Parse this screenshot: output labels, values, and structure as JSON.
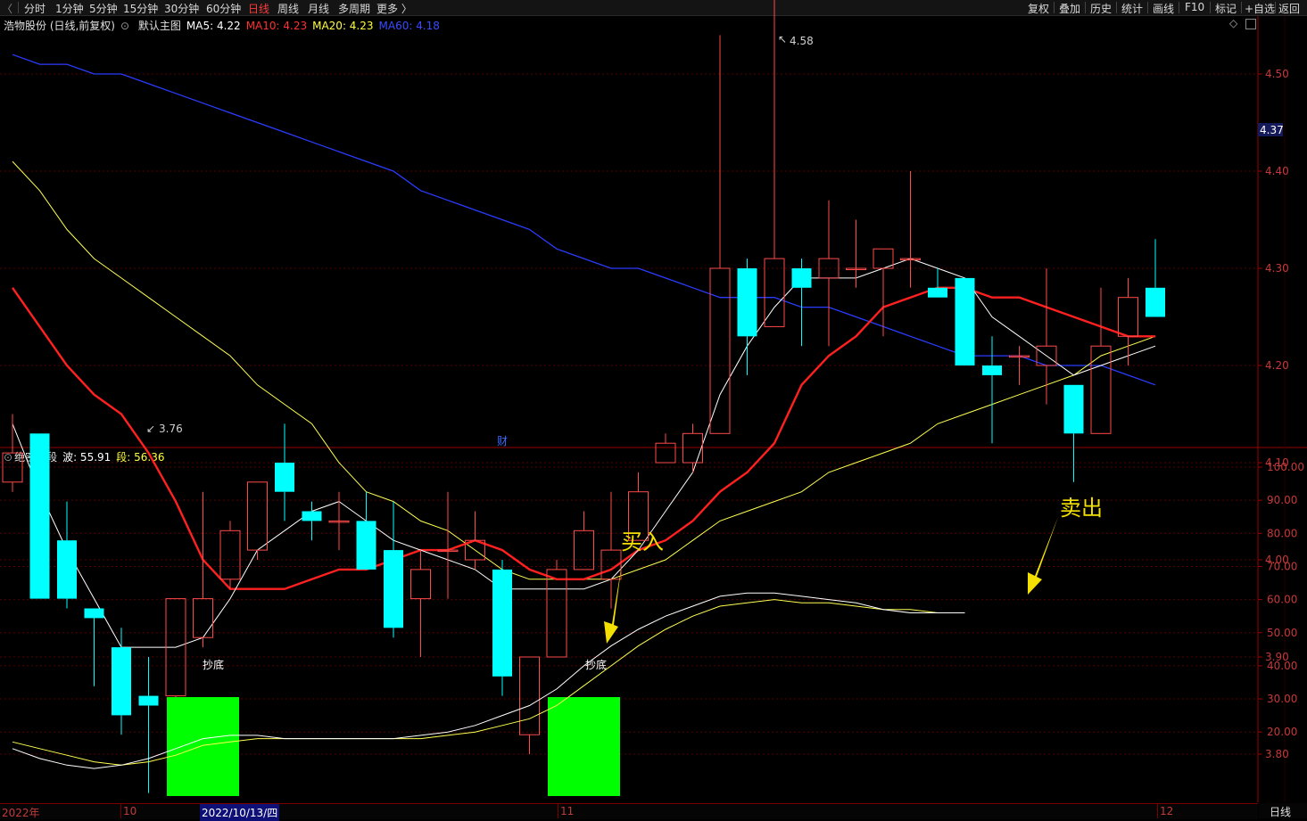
{
  "toolbar": {
    "periods": [
      "分时",
      "1分钟",
      "5分钟",
      "15分钟",
      "30分钟",
      "60分钟",
      "日线",
      "周线",
      "月线",
      "多周期",
      "更多 〉"
    ],
    "active_period": "日线",
    "right_items": [
      "复权",
      "叠加",
      "历史",
      "统计",
      "画线",
      "F10",
      "标记",
      "+自选",
      "返回"
    ]
  },
  "main_info": {
    "stock": "浩物股份 (日线,前复权)",
    "template": "默认主图",
    "ma5": "MA5: 4.22",
    "ma10": "MA10: 4.23",
    "ma20": "MA20: 4.23",
    "ma60": "MA60: 4.18"
  },
  "sub_info": {
    "indicator": "绝密波段",
    "wave": "波: 55.91",
    "segment": "段: 56.36"
  },
  "price_axis": [
    "4.50",
    "4.40",
    "4.30",
    "4.20",
    "4.10",
    "4.00",
    "3.90",
    "3.80"
  ],
  "current_price": "4.37",
  "high_label": "4.58",
  "low_label": "3.76",
  "finance_marker": "财",
  "sub_axis": [
    "100.00",
    "90.00",
    "80.00",
    "70.00",
    "60.00",
    "50.00",
    "40.00",
    "30.00",
    "20.00"
  ],
  "signals": {
    "bottom_label": "抄底",
    "buy": "买入",
    "sell": "卖出"
  },
  "date_axis": {
    "year": "2022年",
    "oct": "10",
    "cursor_date": "2022/10/13/四",
    "nov": "11",
    "dec": "12"
  },
  "period_label": "日线",
  "colors": {
    "up": "#ff4a4a",
    "down": "#00ffff",
    "ma5": "#ffffff",
    "ma10": "#ff2020",
    "ma20": "#ffff50",
    "ma60": "#2a3cff",
    "signal_box": "#00ff00",
    "arrow": "#f3e000"
  },
  "candles": [
    {
      "o": 4.08,
      "h": 4.15,
      "l": 4.07,
      "c": 4.11
    },
    {
      "o": 4.13,
      "h": 4.13,
      "l": 3.96,
      "c": 3.96
    },
    {
      "o": 4.02,
      "h": 4.06,
      "l": 3.95,
      "c": 3.96
    },
    {
      "o": 3.95,
      "h": 3.95,
      "l": 3.87,
      "c": 3.94
    },
    {
      "o": 3.91,
      "h": 3.93,
      "l": 3.82,
      "c": 3.84
    },
    {
      "o": 3.86,
      "h": 3.9,
      "l": 3.76,
      "c": 3.85
    },
    {
      "o": 3.86,
      "h": 3.96,
      "l": 3.83,
      "c": 3.96
    },
    {
      "o": 3.92,
      "h": 4.07,
      "l": 3.91,
      "c": 3.96
    },
    {
      "o": 3.98,
      "h": 4.04,
      "l": 3.97,
      "c": 4.03
    },
    {
      "o": 4.01,
      "h": 4.08,
      "l": 4.0,
      "c": 4.08
    },
    {
      "o": 4.1,
      "h": 4.14,
      "l": 4.04,
      "c": 4.07
    },
    {
      "o": 4.05,
      "h": 4.06,
      "l": 4.02,
      "c": 4.04
    },
    {
      "o": 4.04,
      "h": 4.07,
      "l": 4.01,
      "c": 4.04
    },
    {
      "o": 4.04,
      "h": 4.07,
      "l": 3.99,
      "c": 3.99
    },
    {
      "o": 4.01,
      "h": 4.06,
      "l": 3.92,
      "c": 3.93
    },
    {
      "o": 3.96,
      "h": 4.01,
      "l": 3.9,
      "c": 3.99
    },
    {
      "o": 4.01,
      "h": 4.07,
      "l": 3.96,
      "c": 4.01
    },
    {
      "o": 4.0,
      "h": 4.05,
      "l": 3.99,
      "c": 4.02
    },
    {
      "o": 3.99,
      "h": 4.0,
      "l": 3.86,
      "c": 3.88
    },
    {
      "o": 3.82,
      "h": 3.9,
      "l": 3.8,
      "c": 3.9
    },
    {
      "o": 3.9,
      "h": 4.0,
      "l": 3.9,
      "c": 3.99
    },
    {
      "o": 3.99,
      "h": 4.05,
      "l": 3.99,
      "c": 4.03
    },
    {
      "o": 3.98,
      "h": 4.07,
      "l": 3.95,
      "c": 4.01
    },
    {
      "o": 4.02,
      "h": 4.09,
      "l": 4.02,
      "c": 4.07
    },
    {
      "o": 4.1,
      "h": 4.13,
      "l": 4.1,
      "c": 4.12
    },
    {
      "o": 4.1,
      "h": 4.14,
      "l": 4.09,
      "c": 4.13
    },
    {
      "o": 4.13,
      "h": 4.54,
      "l": 4.13,
      "c": 4.3
    },
    {
      "o": 4.3,
      "h": 4.31,
      "l": 4.19,
      "c": 4.23
    },
    {
      "o": 4.24,
      "h": 4.58,
      "l": 4.24,
      "c": 4.31
    },
    {
      "o": 4.3,
      "h": 4.31,
      "l": 4.22,
      "c": 4.28
    },
    {
      "o": 4.29,
      "h": 4.37,
      "l": 4.22,
      "c": 4.31
    },
    {
      "o": 4.3,
      "h": 4.35,
      "l": 4.28,
      "c": 4.3
    },
    {
      "o": 4.3,
      "h": 4.32,
      "l": 4.23,
      "c": 4.32
    },
    {
      "o": 4.31,
      "h": 4.4,
      "l": 4.28,
      "c": 4.31
    },
    {
      "o": 4.28,
      "h": 4.3,
      "l": 4.27,
      "c": 4.27
    },
    {
      "o": 4.29,
      "h": 4.29,
      "l": 4.2,
      "c": 4.2
    },
    {
      "o": 4.2,
      "h": 4.23,
      "l": 4.12,
      "c": 4.19
    },
    {
      "o": 4.21,
      "h": 4.22,
      "l": 4.18,
      "c": 4.21
    },
    {
      "o": 4.2,
      "h": 4.3,
      "l": 4.16,
      "c": 4.22
    },
    {
      "o": 4.18,
      "h": 4.18,
      "l": 4.08,
      "c": 4.13
    },
    {
      "o": 4.13,
      "h": 4.28,
      "l": 4.13,
      "c": 4.22
    },
    {
      "o": 4.23,
      "h": 4.29,
      "l": 4.2,
      "c": 4.27
    },
    {
      "o": 4.28,
      "h": 4.33,
      "l": 4.25,
      "c": 4.25
    }
  ],
  "ma_series": {
    "ma5": [
      4.14,
      4.07,
      4.01,
      3.96,
      3.91,
      3.91,
      3.91,
      3.92,
      3.96,
      4.01,
      4.03,
      4.05,
      4.06,
      4.04,
      4.02,
      4.01,
      4.0,
      3.99,
      3.97,
      3.97,
      3.97,
      3.97,
      3.98,
      4.01,
      4.05,
      4.09,
      4.17,
      4.22,
      4.26,
      4.29,
      4.29,
      4.29,
      4.3,
      4.31,
      4.3,
      4.29,
      4.25,
      4.23,
      4.21,
      4.19,
      4.2,
      4.21,
      4.22
    ],
    "ma10": [
      4.28,
      4.24,
      4.2,
      4.17,
      4.15,
      4.11,
      4.06,
      4.0,
      3.97,
      3.97,
      3.97,
      3.98,
      3.99,
      3.99,
      4.0,
      4.01,
      4.01,
      4.02,
      4.01,
      3.99,
      3.98,
      3.98,
      3.99,
      4.01,
      4.02,
      4.04,
      4.07,
      4.09,
      4.12,
      4.18,
      4.21,
      4.23,
      4.26,
      4.27,
      4.28,
      4.28,
      4.27,
      4.27,
      4.26,
      4.25,
      4.24,
      4.23,
      4.23
    ],
    "ma20": [
      4.41,
      4.38,
      4.34,
      4.31,
      4.29,
      4.27,
      4.25,
      4.23,
      4.21,
      4.18,
      4.16,
      4.14,
      4.1,
      4.07,
      4.06,
      4.04,
      4.03,
      4.01,
      3.99,
      3.98,
      3.98,
      3.98,
      3.98,
      3.99,
      4.0,
      4.02,
      4.04,
      4.05,
      4.06,
      4.07,
      4.09,
      4.1,
      4.11,
      4.12,
      4.14,
      4.15,
      4.16,
      4.17,
      4.18,
      4.19,
      4.21,
      4.22,
      4.23
    ],
    "ma60": [
      4.52,
      4.51,
      4.51,
      4.5,
      4.5,
      4.49,
      4.48,
      4.47,
      4.46,
      4.45,
      4.44,
      4.43,
      4.42,
      4.41,
      4.4,
      4.38,
      4.37,
      4.36,
      4.35,
      4.34,
      4.32,
      4.31,
      4.3,
      4.3,
      4.29,
      4.28,
      4.27,
      4.27,
      4.27,
      4.26,
      4.26,
      4.25,
      4.24,
      4.23,
      4.22,
      4.21,
      4.21,
      4.21,
      4.2,
      4.2,
      4.2,
      4.19,
      4.18
    ]
  },
  "wave_series": {
    "bo": [
      15,
      12,
      10,
      9,
      10,
      12,
      15,
      18,
      19,
      19,
      18,
      18,
      18,
      18,
      18,
      19,
      20,
      22,
      25,
      28,
      33,
      40,
      46,
      51,
      55,
      58,
      61,
      62,
      62,
      61,
      60,
      59,
      57,
      56,
      56,
      56
    ],
    "duan": [
      17,
      15,
      13,
      11,
      10,
      11,
      13,
      16,
      17,
      18,
      18,
      18,
      18,
      18,
      18,
      18,
      19,
      20,
      22,
      24,
      28,
      34,
      40,
      46,
      51,
      55,
      58,
      59,
      60,
      59,
      59,
      58,
      57,
      57,
      56,
      56
    ]
  },
  "bottom_boxes": [
    {
      "from": 6,
      "to": 8
    },
    {
      "from": 20,
      "to": 22
    }
  ]
}
